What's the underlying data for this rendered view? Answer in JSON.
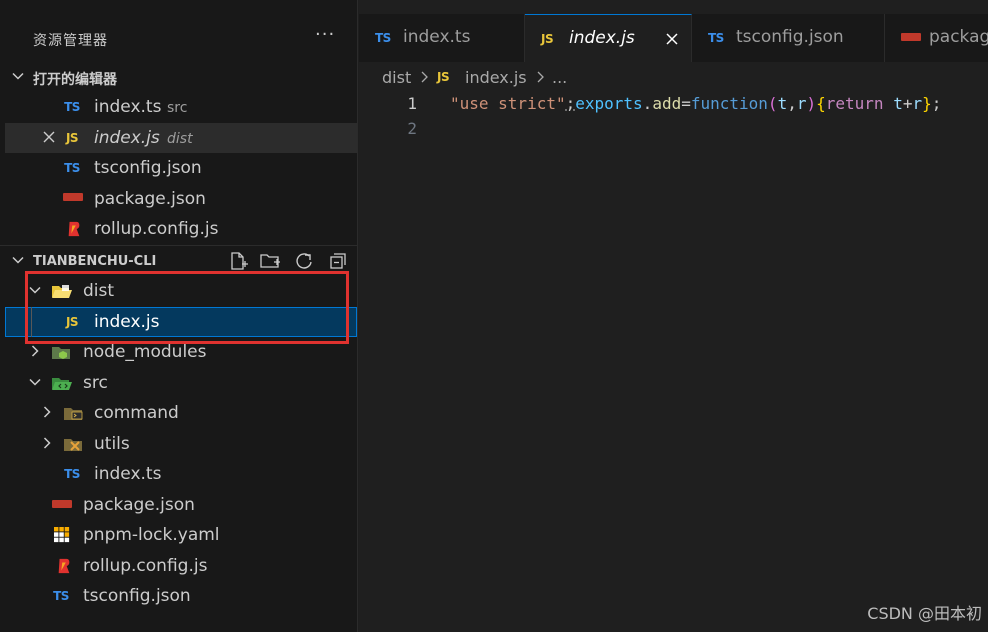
{
  "sidebar": {
    "title": "资源管理器",
    "more": "···",
    "open_editors": {
      "label": "打开的编辑器",
      "items": [
        {
          "icon": "TS",
          "name": "index.ts",
          "desc": "src"
        },
        {
          "icon": "JS",
          "name": "index.js",
          "desc": "dist"
        },
        {
          "icon": "TS",
          "name": "tsconfig.json",
          "desc": ""
        },
        {
          "icon": "npm",
          "name": "package.json",
          "desc": ""
        },
        {
          "icon": "rollup",
          "name": "rollup.config.js",
          "desc": ""
        }
      ]
    },
    "project": {
      "label": "TIANBENCHU-CLI",
      "tree": [
        {
          "name": "dist"
        },
        {
          "icon": "JS",
          "name": "index.js"
        },
        {
          "name": "node_modules"
        },
        {
          "name": "src"
        },
        {
          "name": "command"
        },
        {
          "name": "utils"
        },
        {
          "icon": "TS",
          "name": "index.ts"
        },
        {
          "icon": "npm",
          "name": "package.json"
        },
        {
          "name": "pnpm-lock.yaml"
        },
        {
          "name": "rollup.config.js"
        },
        {
          "icon": "TS",
          "name": "tsconfig.json"
        }
      ]
    }
  },
  "editor": {
    "tabs": [
      {
        "icon": "TS",
        "label": "index.ts"
      },
      {
        "icon": "JS",
        "label": "index.js"
      },
      {
        "icon": "TS",
        "label": "tsconfig.json"
      },
      {
        "icon": "npm",
        "label": "packag"
      }
    ],
    "breadcrumb": {
      "folder": "dist",
      "file_icon": "JS",
      "file": "index.js",
      "more": "..."
    },
    "lines": [
      {
        "number": "1"
      },
      {
        "number": "2"
      }
    ],
    "code_line_1": {
      "t1": "\"use strict\"",
      "t2": ";",
      "t3": "exports",
      "t4": ".",
      "t5": "add",
      "t6": "=",
      "t7": "function",
      "t8": "(",
      "t9": "t",
      "t10": ",",
      "t11": "r",
      "t12": ")",
      "t13": "{",
      "t14": "return",
      "t15": " t",
      "t16": "+",
      "t17": "r",
      "t18": "}",
      "t19": ";"
    }
  },
  "watermark": "CSDN @田本初",
  "colors": {
    "ts": "#3b8eea",
    "js": "#e8c53a",
    "highlight": "#e0322f",
    "selection": "#04395e",
    "focus": "#0078d4"
  }
}
